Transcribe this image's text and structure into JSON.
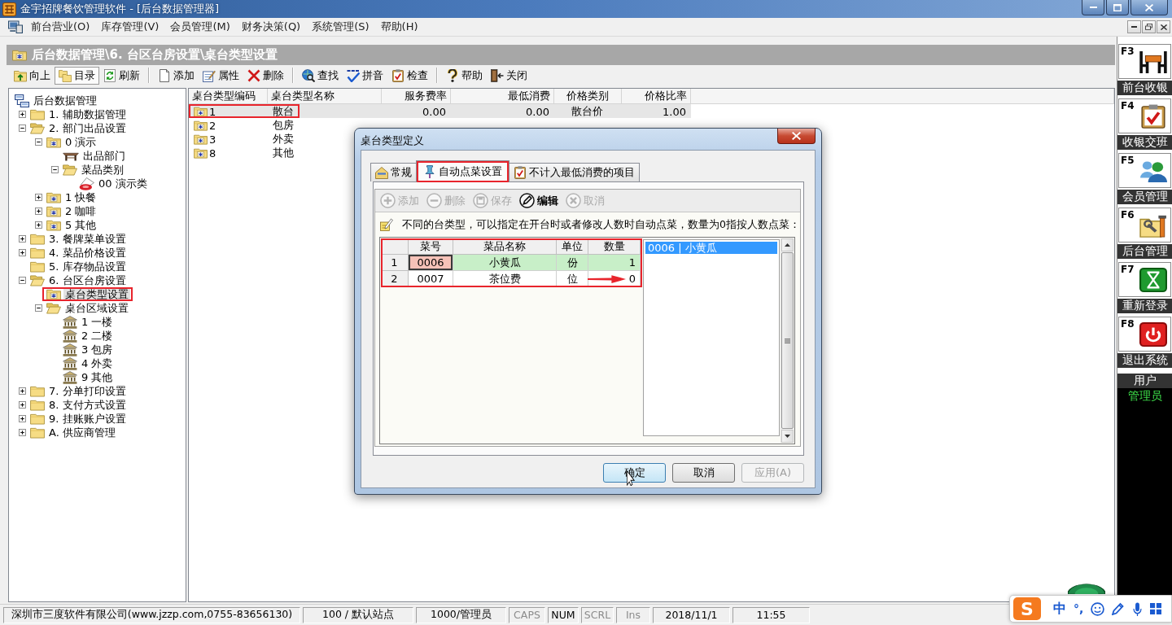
{
  "window": {
    "title": "金宇招牌餐饮管理软件 - [后台数据管理器]"
  },
  "menu": [
    "前台营业(O)",
    "库存管理(V)",
    "会员管理(M)",
    "财务决策(Q)",
    "系统管理(S)",
    "帮助(H)"
  ],
  "header": {
    "path": "后台数据管理\\6. 台区台房设置\\桌台类型设置"
  },
  "toolbar": [
    [
      {
        "label": "向上",
        "kind": "up",
        "pressed": false
      },
      {
        "label": "目录",
        "kind": "catalog",
        "pressed": true
      },
      {
        "label": "刷新",
        "kind": "refresh",
        "pressed": false
      }
    ],
    [
      {
        "label": "添加",
        "kind": "add",
        "pressed": false
      },
      {
        "label": "属性",
        "kind": "properties",
        "pressed": false
      },
      {
        "label": "删除",
        "kind": "delete",
        "pressed": false
      }
    ],
    [
      {
        "label": "查找",
        "kind": "find",
        "pressed": false
      },
      {
        "label": "拼音",
        "kind": "pinyin",
        "pressed": false
      },
      {
        "label": "检查",
        "kind": "check",
        "pressed": false
      }
    ],
    [
      {
        "label": "帮助",
        "kind": "help",
        "pressed": false
      },
      {
        "label": "关闭",
        "kind": "close",
        "pressed": false
      }
    ]
  ],
  "tree": {
    "label": "后台数据管理",
    "kind": "root",
    "selected": false,
    "annotated": false,
    "children": [
      {
        "label": "1. 辅助数据管理",
        "kind": "folder",
        "expanded": false,
        "selected": false,
        "annotated": false
      },
      {
        "label": "2. 部门出品设置",
        "kind": "folder",
        "expanded": true,
        "selected": false,
        "annotated": false,
        "children": [
          {
            "label": "0 演示",
            "kind": "record",
            "expanded": true,
            "selected": false,
            "annotated": false,
            "children": [
              {
                "label": "出品部门",
                "kind": "department",
                "selected": false,
                "annotated": false
              },
              {
                "label": "菜品类别",
                "kind": "folder",
                "expanded": true,
                "selected": false,
                "annotated": false,
                "children": [
                  {
                    "label": "00 演示类",
                    "kind": "dish-class",
                    "selected": false,
                    "annotated": false
                  }
                ]
              }
            ]
          },
          {
            "label": "1 快餐",
            "kind": "record",
            "expanded": false,
            "selected": false,
            "annotated": false
          },
          {
            "label": "2 咖啡",
            "kind": "record",
            "expanded": false,
            "selected": false,
            "annotated": false
          },
          {
            "label": "5 其他",
            "kind": "record",
            "expanded": false,
            "selected": false,
            "annotated": false
          }
        ]
      },
      {
        "label": "3. 餐牌菜单设置",
        "kind": "folder",
        "expanded": false,
        "selected": false,
        "annotated": false
      },
      {
        "label": "4. 菜品价格设置",
        "kind": "folder",
        "expanded": false,
        "selected": false,
        "annotated": false
      },
      {
        "label": "5. 库存物品设置",
        "kind": "folder",
        "selected": false,
        "annotated": false
      },
      {
        "label": "6. 台区台房设置",
        "kind": "folder",
        "expanded": true,
        "selected": false,
        "annotated": false,
        "children": [
          {
            "label": "桌台类型设置",
            "kind": "record",
            "selected": true,
            "annotated": true
          },
          {
            "label": "桌台区域设置",
            "kind": "folder",
            "expanded": true,
            "selected": false,
            "annotated": false,
            "children": [
              {
                "label": "1 一楼",
                "kind": "area",
                "selected": false,
                "annotated": false
              },
              {
                "label": "2 二楼",
                "kind": "area",
                "selected": false,
                "annotated": false
              },
              {
                "label": "3 包房",
                "kind": "area",
                "selected": false,
                "annotated": false
              },
              {
                "label": "4 外卖",
                "kind": "area",
                "selected": false,
                "annotated": false
              },
              {
                "label": "9 其他",
                "kind": "area",
                "selected": false,
                "annotated": false
              }
            ]
          }
        ]
      },
      {
        "label": "7. 分单打印设置",
        "kind": "folder",
        "expanded": false,
        "selected": false,
        "annotated": false
      },
      {
        "label": "8. 支付方式设置",
        "kind": "folder",
        "expanded": false,
        "selected": false,
        "annotated": false
      },
      {
        "label": "9. 挂账账户设置",
        "kind": "folder",
        "expanded": false,
        "selected": false,
        "annotated": false
      },
      {
        "label": "A. 供应商管理",
        "kind": "folder",
        "expanded": false,
        "selected": false,
        "annotated": false
      }
    ]
  },
  "list": {
    "columns": [
      "桌台类型编码",
      "桌台类型名称",
      "服务费率",
      "最低消费",
      "价格类别",
      "价格比率"
    ],
    "rows": [
      {
        "cells": [
          "1",
          "散台",
          "0.00",
          "0.00",
          "散台价",
          "1.00"
        ],
        "selected": true,
        "annotated": true
      },
      {
        "cells": [
          "2",
          "包房"
        ],
        "selected": false,
        "annotated": false
      },
      {
        "cells": [
          "3",
          "外卖"
        ],
        "selected": false,
        "annotated": false
      },
      {
        "cells": [
          "8",
          "其他"
        ],
        "selected": false,
        "annotated": false
      }
    ]
  },
  "dialog": {
    "title": "桌台类型定义",
    "tabs": [
      {
        "label": "常规",
        "kind": "general",
        "selected": false,
        "annotated": false
      },
      {
        "label": "自动点菜设置",
        "kind": "auto-order",
        "selected": true,
        "annotated": true
      },
      {
        "label": "不计入最低消费的项目",
        "kind": "excluded",
        "selected": false,
        "annotated": false
      }
    ],
    "toolbar": [
      {
        "label": "添加",
        "kind": "add",
        "disabled": true
      },
      {
        "label": "删除",
        "kind": "delete",
        "disabled": true
      },
      {
        "label": "保存",
        "kind": "save",
        "disabled": true
      },
      {
        "label": "编辑",
        "kind": "edit",
        "disabled": false
      },
      {
        "label": "取消",
        "kind": "cancel",
        "disabled": true
      }
    ],
    "note": "不同的台类型，可以指定在开台时或者修改人数时自动点菜，数量为0指按人数点菜：",
    "grid": {
      "annotated": true,
      "columns": [
        "菜号",
        "菜品名称",
        "单位",
        "数量"
      ],
      "rows": [
        {
          "number": "1",
          "selected": true,
          "cells": [
            {
              "text": "0006",
              "current": true,
              "arrow": false
            },
            {
              "text": "小黄瓜",
              "current": false,
              "arrow": false
            },
            {
              "text": "份",
              "current": false,
              "arrow": false
            },
            {
              "text": "1",
              "current": false,
              "arrow": false
            }
          ]
        },
        {
          "number": "2",
          "selected": false,
          "cells": [
            {
              "text": "0007",
              "current": false,
              "arrow": false
            },
            {
              "text": "茶位费",
              "current": false,
              "arrow": false
            },
            {
              "text": "位",
              "current": false,
              "arrow": false
            },
            {
              "text": "0",
              "current": false,
              "arrow": true
            }
          ]
        }
      ]
    },
    "picked": [
      {
        "label": "0006 | 小黄瓜",
        "selected": true
      }
    ],
    "buttons": [
      {
        "label": "确定",
        "default": true,
        "disabled": false
      },
      {
        "label": "取消",
        "default": false,
        "disabled": false
      },
      {
        "label": "应用(A)",
        "default": false,
        "disabled": true
      }
    ]
  },
  "shortcuts": [
    {
      "key": "F3",
      "label": "前台收银",
      "kind": "cashier"
    },
    {
      "key": "F4",
      "label": "收银交班",
      "kind": "shift"
    },
    {
      "key": "F5",
      "label": "会员管理",
      "kind": "members"
    },
    {
      "key": "F6",
      "label": "后台管理",
      "kind": "backend"
    },
    {
      "key": "F7",
      "label": "重新登录",
      "kind": "relogin"
    },
    {
      "key": "F8",
      "label": "退出系统",
      "kind": "exit"
    }
  ],
  "user": {
    "label": "用户",
    "name": "管理员"
  },
  "status_bar": [
    {
      "text": "深圳市三度软件有限公司(www.jzzp.com,0755-83656130)",
      "dimmed": false
    },
    {
      "text": "100 / 默认站点",
      "dimmed": false
    },
    {
      "text": "1000/管理员",
      "dimmed": false
    },
    {
      "text": "CAPS",
      "dimmed": true
    },
    {
      "text": "NUM",
      "dimmed": false
    },
    {
      "text": "SCRL",
      "dimmed": true
    },
    {
      "text": "Ins",
      "dimmed": true
    },
    {
      "text": "2018/11/1",
      "dimmed": false
    },
    {
      "text": "11:55",
      "dimmed": false
    }
  ],
  "ime": {
    "logo": "S",
    "mode": "中",
    "punctuation": "°,"
  }
}
